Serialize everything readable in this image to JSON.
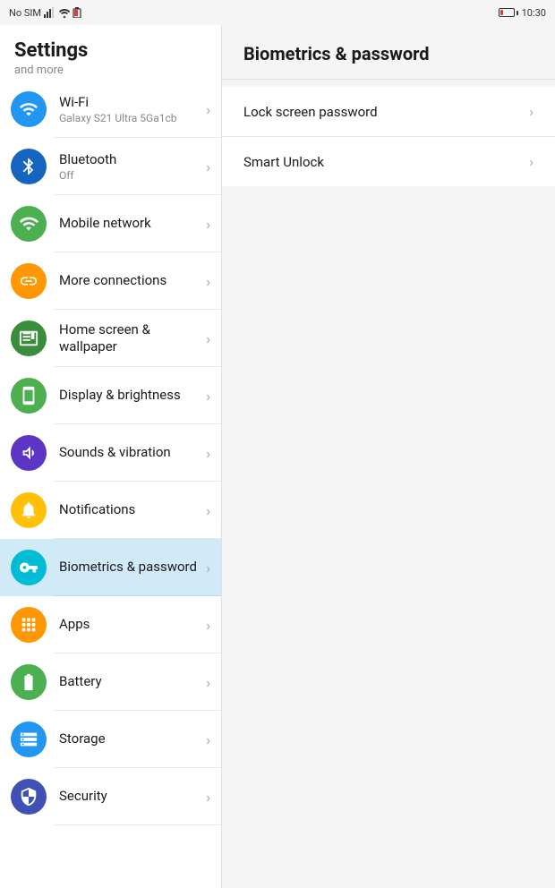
{
  "statusBar": {
    "left": "No SIM",
    "time": "10:30"
  },
  "sidebar": {
    "title": "Settings",
    "subtitle": "and more",
    "items": [
      {
        "id": "wifi",
        "label": "Wi-Fi",
        "sublabel": "Galaxy S21 Ultra 5Ga1cb",
        "iconColor": "bg-blue",
        "icon": "wifi",
        "active": false
      },
      {
        "id": "bluetooth",
        "label": "Bluetooth",
        "sublabel": "Off",
        "iconColor": "bg-blue-dark",
        "icon": "bluetooth",
        "active": false
      },
      {
        "id": "mobile-network",
        "label": "Mobile network",
        "sublabel": "",
        "iconColor": "bg-green",
        "icon": "mobile",
        "active": false
      },
      {
        "id": "more-connections",
        "label": "More connections",
        "sublabel": "",
        "iconColor": "bg-orange",
        "icon": "link",
        "active": false
      },
      {
        "id": "home-screen",
        "label": "Home screen & wallpaper",
        "sublabel": "",
        "iconColor": "bg-green-dark",
        "icon": "home",
        "active": false
      },
      {
        "id": "display",
        "label": "Display & brightness",
        "sublabel": "",
        "iconColor": "bg-green",
        "icon": "display",
        "active": false
      },
      {
        "id": "sounds",
        "label": "Sounds & vibration",
        "sublabel": "",
        "iconColor": "bg-purple",
        "icon": "sound",
        "active": false
      },
      {
        "id": "notifications",
        "label": "Notifications",
        "sublabel": "",
        "iconColor": "bg-amber",
        "icon": "notification",
        "active": false
      },
      {
        "id": "biometrics",
        "label": "Biometrics & password",
        "sublabel": "",
        "iconColor": "bg-cyan",
        "icon": "key",
        "active": true
      },
      {
        "id": "apps",
        "label": "Apps",
        "sublabel": "",
        "iconColor": "bg-orange",
        "icon": "apps",
        "active": false
      },
      {
        "id": "battery",
        "label": "Battery",
        "sublabel": "",
        "iconColor": "bg-green",
        "icon": "battery",
        "active": false
      },
      {
        "id": "storage",
        "label": "Storage",
        "sublabel": "",
        "iconColor": "bg-blue",
        "icon": "storage",
        "active": false
      },
      {
        "id": "security",
        "label": "Security",
        "sublabel": "",
        "iconColor": "bg-indigo",
        "icon": "security",
        "active": false
      }
    ]
  },
  "panel": {
    "title": "Biometrics & password",
    "items": [
      {
        "id": "lock-screen-password",
        "label": "Lock screen password"
      },
      {
        "id": "smart-unlock",
        "label": "Smart Unlock"
      }
    ]
  }
}
